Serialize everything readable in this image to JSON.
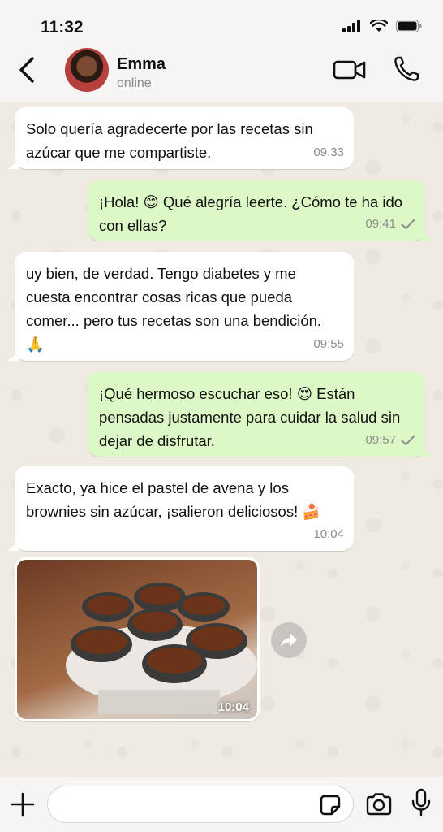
{
  "status_bar": {
    "time": "11:32"
  },
  "header": {
    "contact_name": "Emma",
    "contact_status": "online"
  },
  "messages": [
    {
      "direction": "in",
      "text": "Solo quería agradecerte por las recetas sin azúcar que me compartiste.",
      "time": "09:33"
    },
    {
      "direction": "out",
      "text": "¡Hola! 😊 Qué alegría leerte. ¿Cómo te ha ido con ellas?",
      "time": "09:41",
      "status": "delivered"
    },
    {
      "direction": "in",
      "text": "uy bien, de verdad. Tengo diabetes y me cuesta encontrar cosas ricas que pueda comer... pero tus recetas son una bendición. 🙏",
      "time": "09:55"
    },
    {
      "direction": "out",
      "text": "¡Qué hermoso escuchar eso! 😍 Están pensadas justamente para cuidar la salud sin dejar de disfrutar.",
      "time": "09:57",
      "status": "delivered"
    },
    {
      "direction": "in",
      "text": "Exacto, ya hice el pastel de avena y los brownies sin azúcar, ¡salieron deliciosos! 🍰",
      "time": "10:04"
    },
    {
      "direction": "in",
      "type": "photo",
      "time": "10:04"
    }
  ],
  "input": {
    "placeholder": ""
  },
  "colors": {
    "incoming_bubble": "#ffffff",
    "outgoing_bubble": "#dcf8c6",
    "background": "#efeae2"
  }
}
